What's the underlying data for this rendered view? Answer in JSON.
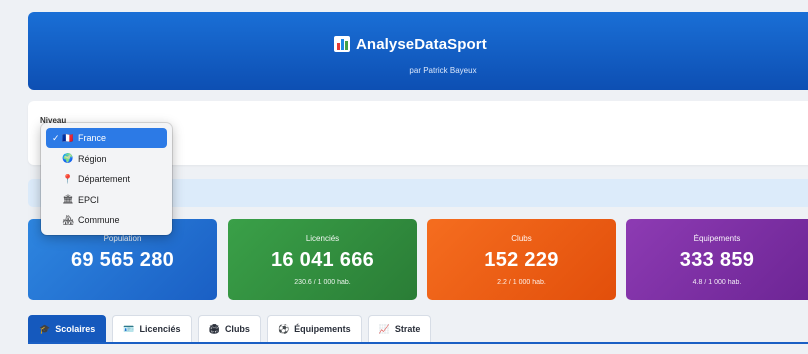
{
  "header": {
    "title": "AnalyseDataSport",
    "subtitle": "par Patrick Bayeux",
    "logo_icon": "bar-chart-icon"
  },
  "filter": {
    "label": "Niveau",
    "selected": "France",
    "options": [
      {
        "label": "France",
        "icon": "🇫🇷",
        "selected": true
      },
      {
        "label": "Région",
        "icon": "🌍",
        "selected": false
      },
      {
        "label": "Département",
        "icon": "📍",
        "selected": false
      },
      {
        "label": "EPCI",
        "icon": "🏛",
        "selected": false
      },
      {
        "label": "Commune",
        "icon": "🏘",
        "selected": false
      }
    ]
  },
  "stats": [
    {
      "label": "Population",
      "value": "69 565 280",
      "sub": ""
    },
    {
      "label": "Licenciés",
      "value": "16 041 666",
      "sub": "230.6 / 1 000 hab."
    },
    {
      "label": "Clubs",
      "value": "152 229",
      "sub": "2.2 / 1 000 hab."
    },
    {
      "label": "Équipements",
      "value": "333 859",
      "sub": "4.8 / 1 000 hab."
    }
  ],
  "tabs": [
    {
      "label": "Scolaires",
      "icon": "🎓",
      "active": true
    },
    {
      "label": "Licenciés",
      "icon": "🪪",
      "active": false
    },
    {
      "label": "Clubs",
      "icon": "🏟",
      "active": false
    },
    {
      "label": "Équipements",
      "icon": "⚽",
      "active": false
    },
    {
      "label": "Strate",
      "icon": "📈",
      "active": false
    }
  ],
  "colors": {
    "header": "#0d4fb3",
    "population": "#1a5fc4",
    "licencies": "#2a7d36",
    "clubs": "#e24f0b",
    "equipements": "#6d2595"
  }
}
